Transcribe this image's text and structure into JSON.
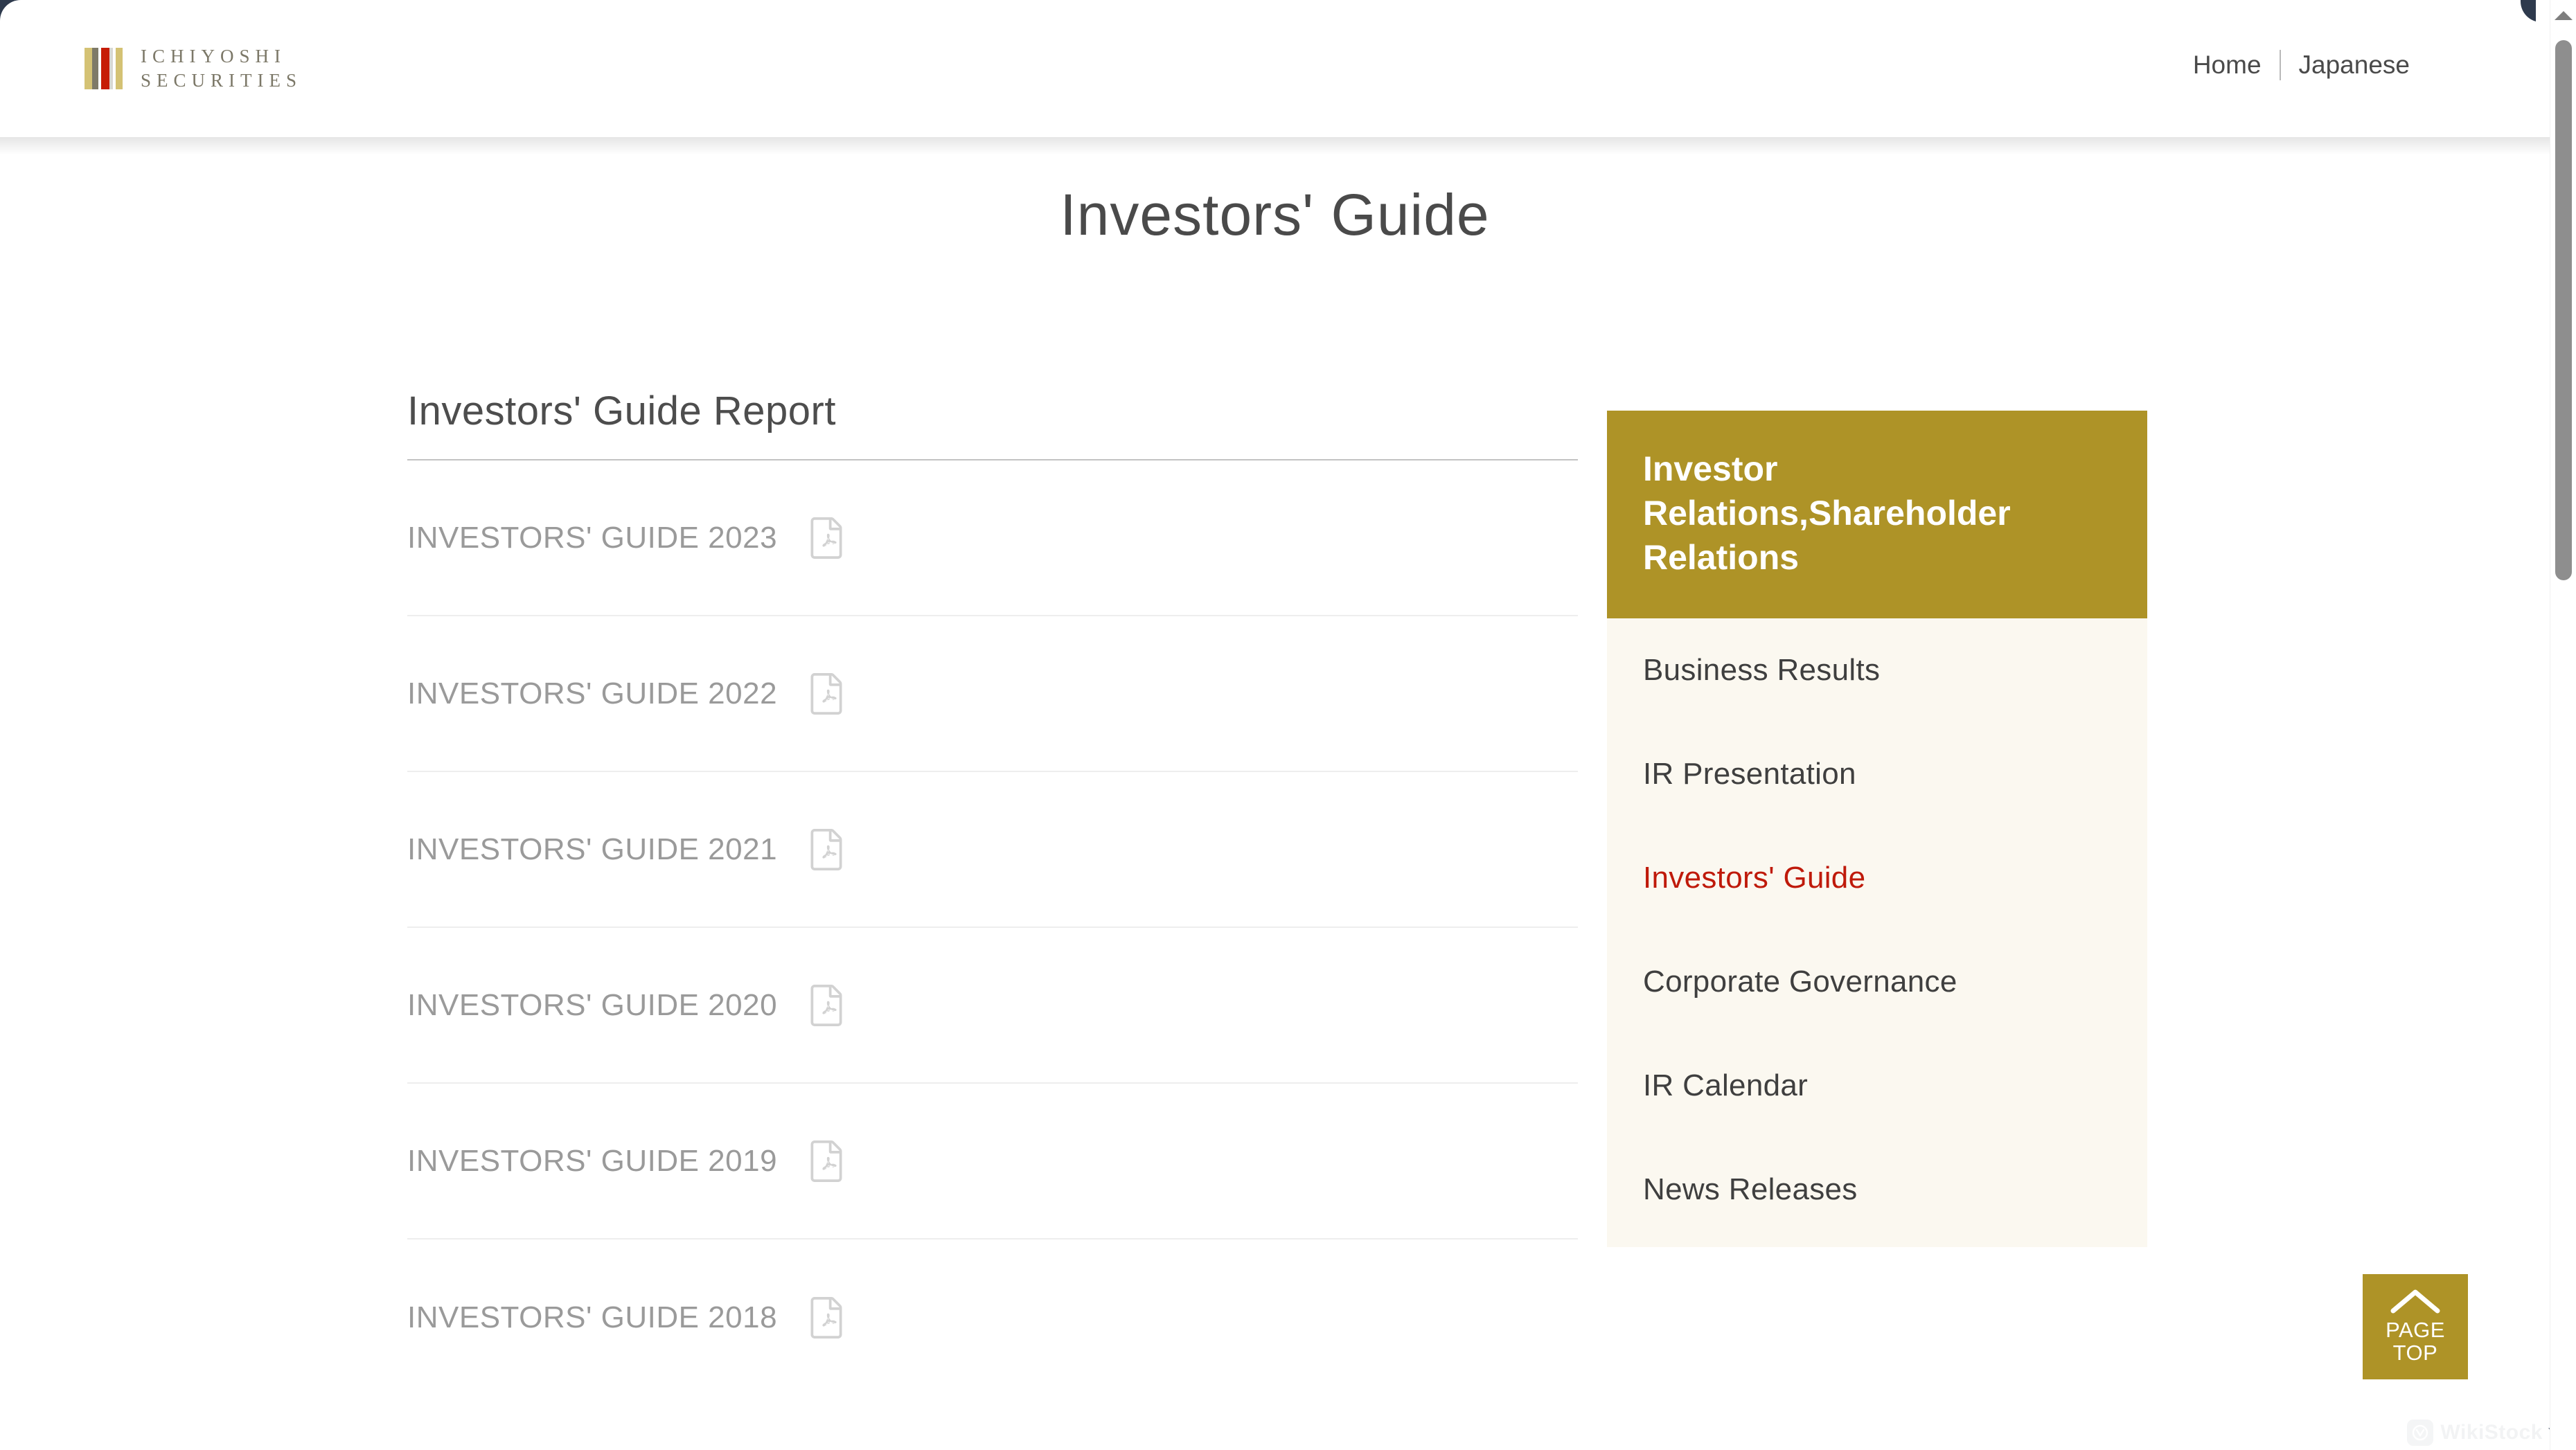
{
  "header": {
    "logo": {
      "line1": "ICHIYOSHI",
      "line2": "SECURITIES",
      "bar_colors": [
        "#d4c274",
        "#7e7a68",
        "#ffffff",
        "#c61c06",
        "#d8d8d4",
        "#ffffff",
        "#d4c274"
      ]
    },
    "nav": [
      {
        "label": "Home",
        "name": "nav-link-home"
      },
      {
        "label": "Japanese",
        "name": "nav-link-japanese"
      }
    ]
  },
  "page": {
    "title": "Investors' Guide"
  },
  "main": {
    "section_heading": "Investors' Guide Report",
    "reports": [
      {
        "label": "INVESTORS' GUIDE 2023",
        "icon": "pdf-file-icon"
      },
      {
        "label": "INVESTORS' GUIDE 2022",
        "icon": "pdf-file-icon"
      },
      {
        "label": "INVESTORS' GUIDE 2021",
        "icon": "pdf-file-icon"
      },
      {
        "label": "INVESTORS' GUIDE 2020",
        "icon": "pdf-file-icon"
      },
      {
        "label": "INVESTORS' GUIDE 2019",
        "icon": "pdf-file-icon"
      },
      {
        "label": "INVESTORS' GUIDE 2018",
        "icon": "pdf-file-icon"
      }
    ]
  },
  "sidebar": {
    "header_title": "Investor Relations,Shareholder Relations",
    "header_color": "#AE9327",
    "body_color": "#FBF8F0",
    "active_color": "#BF1A0A",
    "items": [
      {
        "label": "Business Results",
        "active": false
      },
      {
        "label": "IR Presentation",
        "active": false
      },
      {
        "label": "Investors' Guide",
        "active": true
      },
      {
        "label": "Corporate Governance",
        "active": false
      },
      {
        "label": "IR Calendar",
        "active": false
      },
      {
        "label": "News Releases",
        "active": false
      }
    ]
  },
  "page_top": {
    "line1": "PAGE",
    "line2": "TOP",
    "icon": "chevron-up-icon",
    "color": "#AE9327"
  },
  "watermark": {
    "text": "WikiStock"
  }
}
